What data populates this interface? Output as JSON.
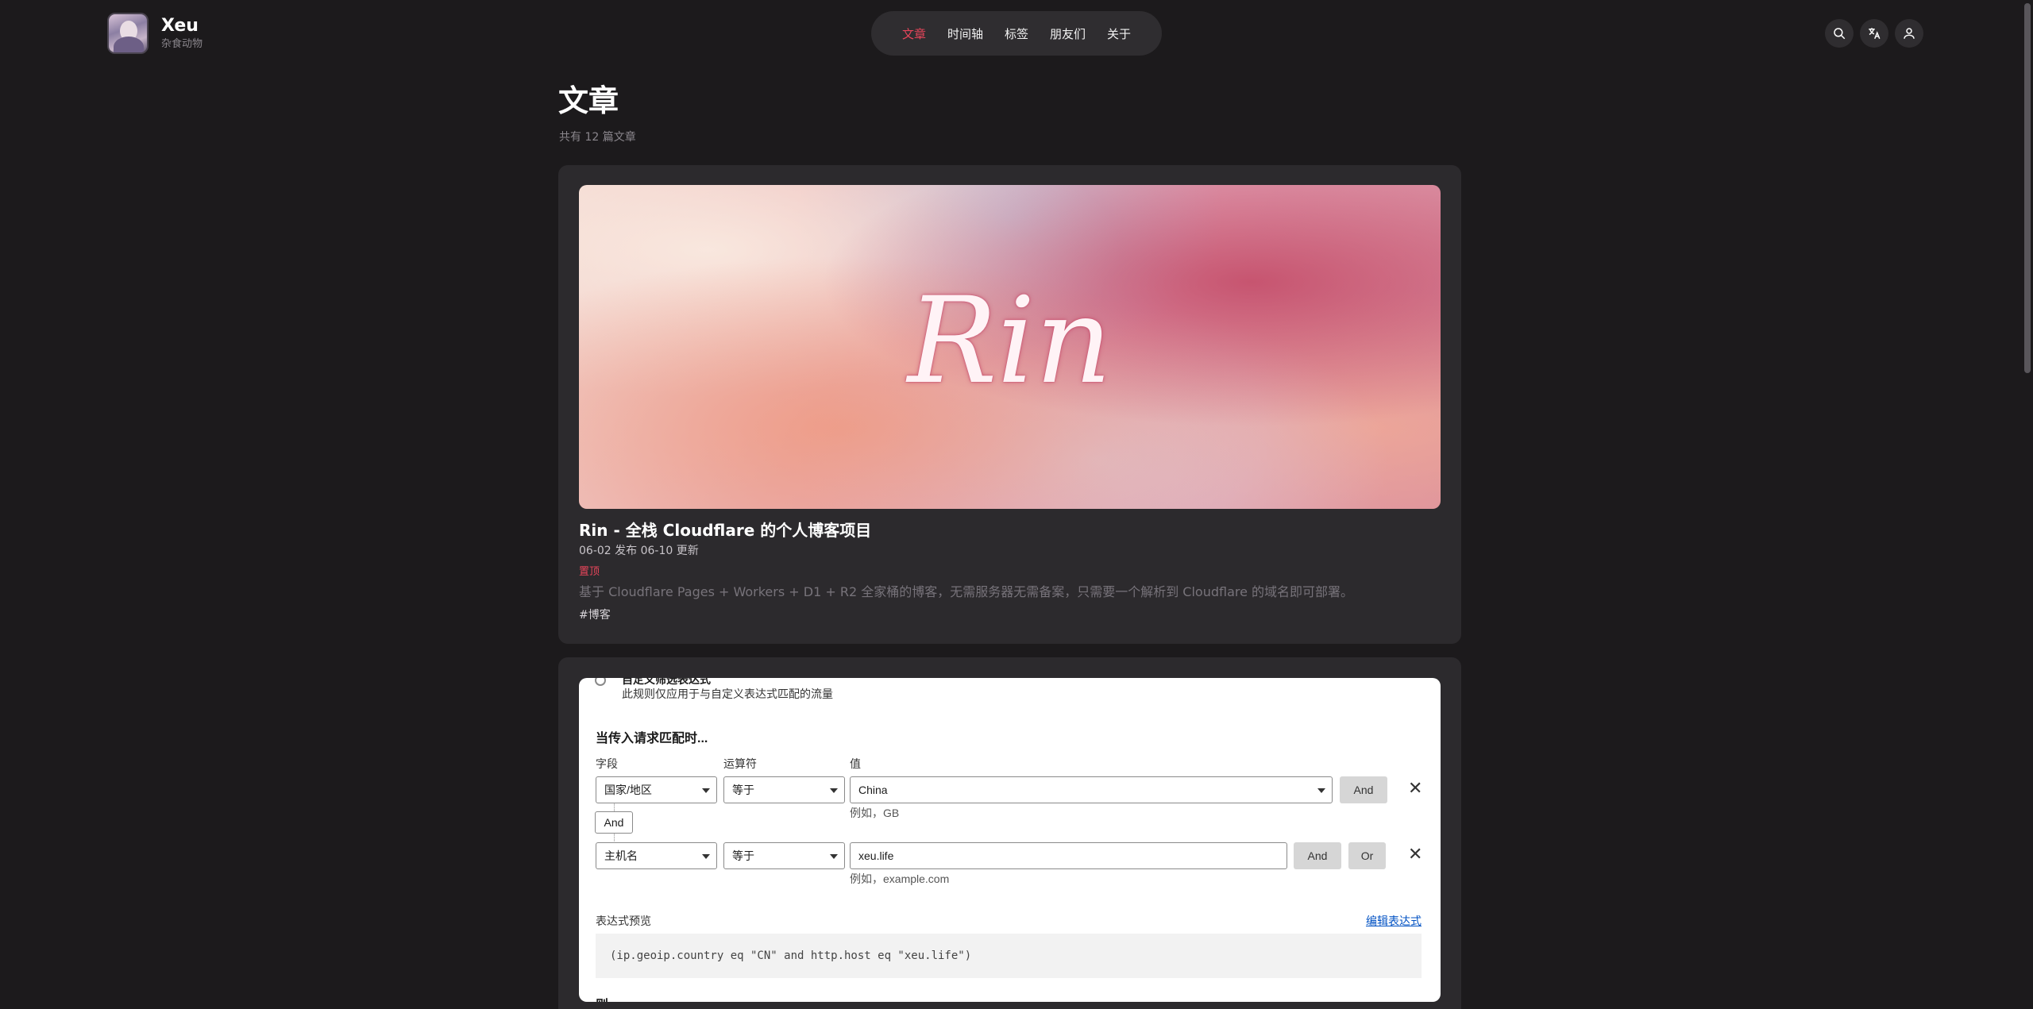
{
  "header": {
    "brand_name": "Xeu",
    "brand_subtitle": "杂食动物",
    "nav": [
      "文章",
      "时间轴",
      "标签",
      "朋友们",
      "关于"
    ],
    "active_nav": "文章",
    "icons": [
      "search-icon",
      "translate-icon",
      "user-icon"
    ]
  },
  "page": {
    "title": "文章",
    "count_text": "共有 12 篇文章"
  },
  "posts": [
    {
      "cover_text": "Rin",
      "title": "Rin - 全栈 Cloudflare 的个人博客项目",
      "dates": "06-02 发布  06-10 更新",
      "pinned": "置顶",
      "description": "基于 Cloudflare Pages + Workers + D1 + R2 全家桶的博客，无需服务器无需备案，只需要一个解析到 Cloudflare 的域名即可部署。",
      "tag": "#博客"
    }
  ],
  "rule_screenshot": {
    "cut_top_label": "自定义筛选表达式",
    "subtitle": "此规则仅应用于与自定义表达式匹配的流量",
    "when_label": "当传入请求匹配时...",
    "columns": {
      "field": "字段",
      "operator": "运算符",
      "value": "值"
    },
    "rows": [
      {
        "field": "国家/地区",
        "operator": "等于",
        "value": "China",
        "hint": "例如，GB",
        "buttons": [
          "And"
        ]
      },
      {
        "field": "主机名",
        "operator": "等于",
        "value": "xeu.life",
        "hint": "例如，example.com",
        "buttons": [
          "And",
          "Or"
        ]
      }
    ],
    "and_chip": "And",
    "preview_label": "表达式预览",
    "edit_link": "编辑表达式",
    "expression": "(ip.geoip.country eq \"CN\" and http.host eq \"xeu.life\")",
    "cut_bottom_label": "则..."
  },
  "colors": {
    "background": "#1c1a1c",
    "card": "#2c2a2d",
    "accent": "#e8455a",
    "link_blue": "#0051c3"
  }
}
